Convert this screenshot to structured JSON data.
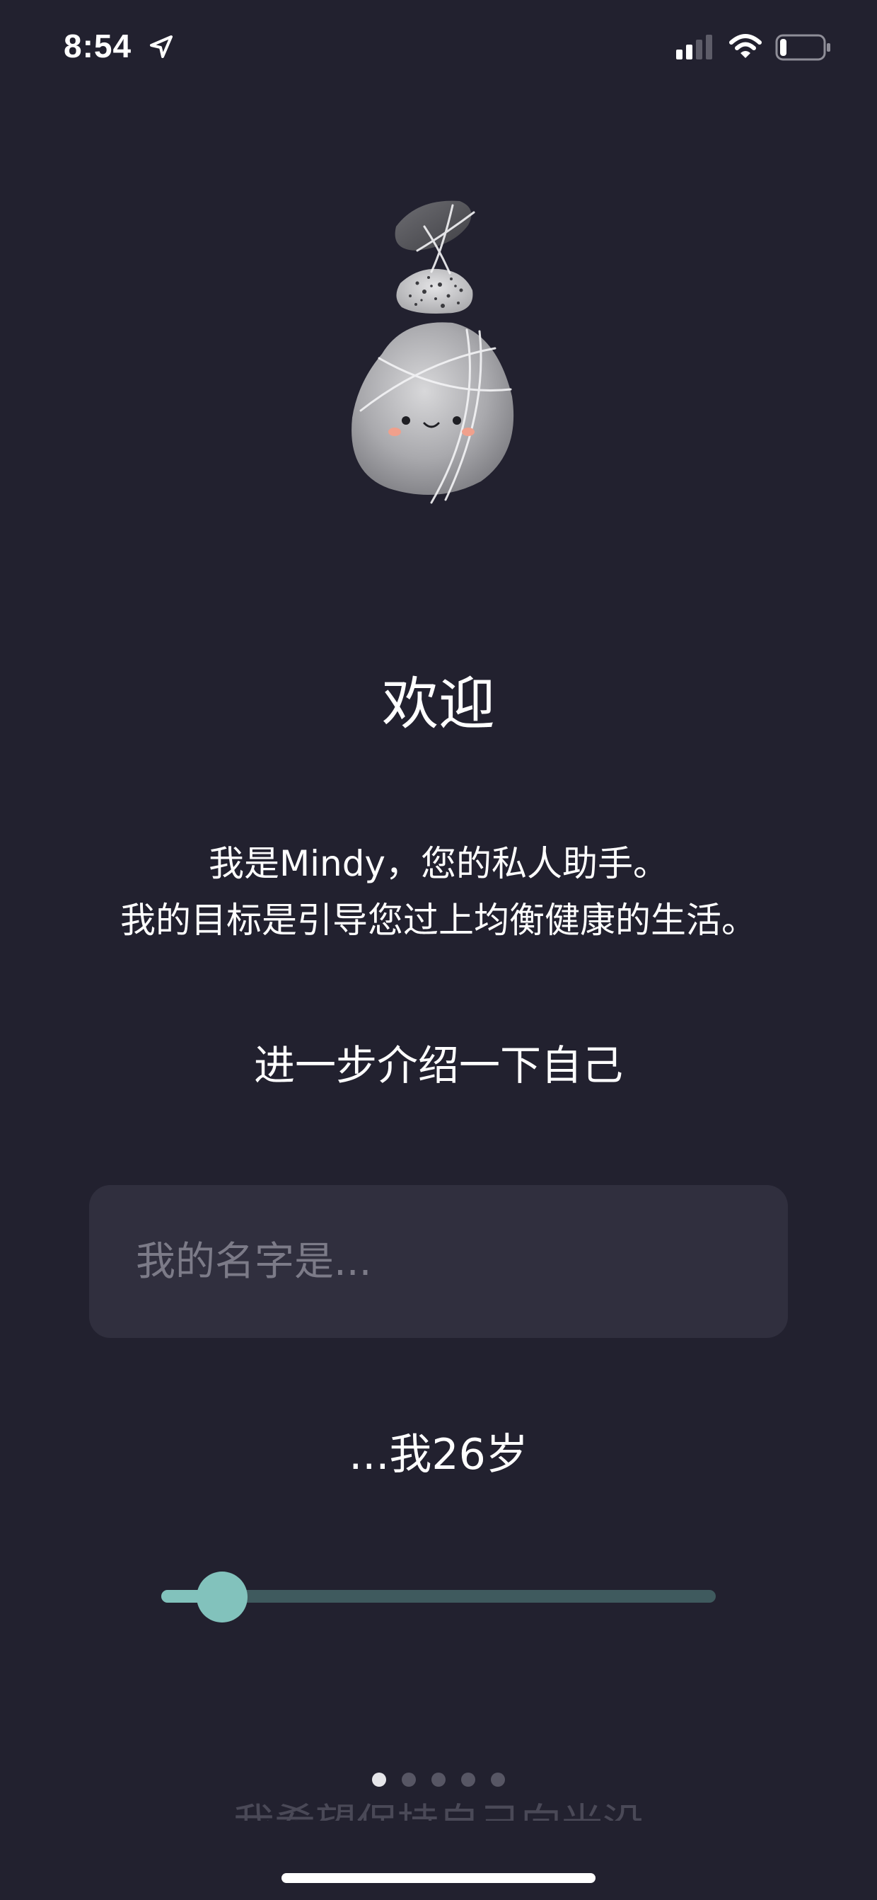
{
  "status_bar": {
    "time": "8:54",
    "icons": [
      "location-arrow-icon",
      "cellular-signal-icon",
      "wifi-icon",
      "battery-icon"
    ],
    "battery_level": 0.15
  },
  "mascot": {
    "name": "stacked-stones-mascot"
  },
  "welcome": {
    "title": "欢迎",
    "intro_line1": "我是Mindy，您的私人助手。",
    "intro_line2": "我的目标是引导您过上均衡健康的生活。"
  },
  "profile": {
    "subtitle": "进一步介绍一下自己",
    "name_placeholder": "我的名字是...",
    "name_value": "",
    "age_label": "...我26岁",
    "age_slider_fraction": 0.11
  },
  "pagination": {
    "total": 5,
    "active_index": 0
  },
  "next_hint": "我希望保持自己向光沿",
  "colors": {
    "background": "#22212f",
    "field_background": "#302f3e",
    "accent": "#82c2bc",
    "track": "#3f5a5e"
  }
}
